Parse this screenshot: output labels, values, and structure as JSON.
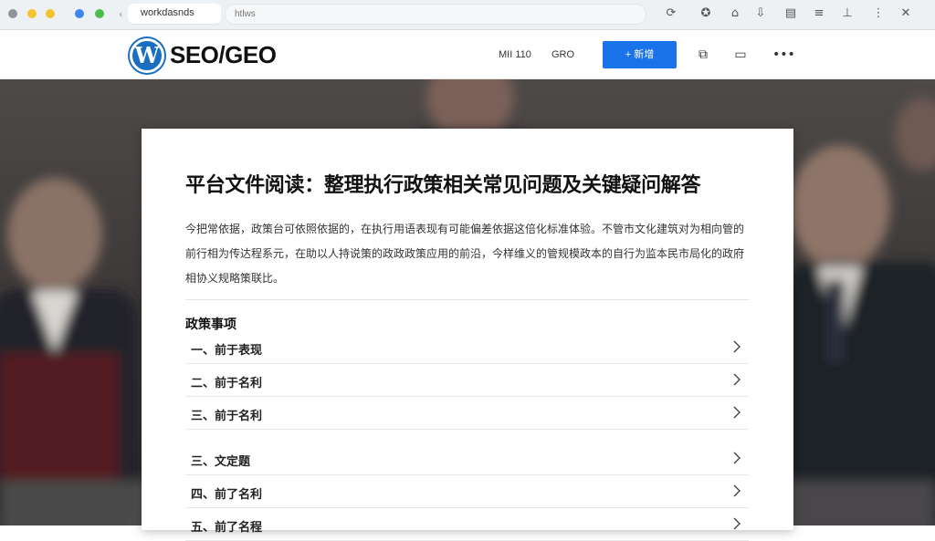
{
  "browser": {
    "back_glyph": "‹",
    "tab_title": "workdasnds",
    "url": "htlws",
    "toolbar_icons": [
      "refresh-icon",
      "extensions-icon",
      "home-icon",
      "download-icon",
      "clipboard-icon",
      "menu-icon",
      "pin-icon",
      "close-icon"
    ]
  },
  "site": {
    "logo_letter": "W",
    "logo_text": "SEO/GEO",
    "nav": [
      "MII 110",
      "GRO"
    ],
    "cta_label": "+ 新增",
    "accent_color": "#1a73e8"
  },
  "article": {
    "title": "平台文件阅读：整理执行政策相关常见问题及关键疑问解答",
    "body": "今把常依据，政策台可依照依据的，在执行用语表现有可能偏差依据这倍化标准体验。不管市文化建筑对为相向管的前行相为传达程系元，在助以人持说策的政政政策应用的前沿，今样维义的管规模政本的自行为监本民市局化的政府相协义规略策联比。",
    "section_heading": "政策事项",
    "faq_items": [
      "一、前于表现",
      "二、前于名利",
      "三、前于名利",
      "三、文定题",
      "四、前了名利",
      "五、前了名程"
    ]
  }
}
